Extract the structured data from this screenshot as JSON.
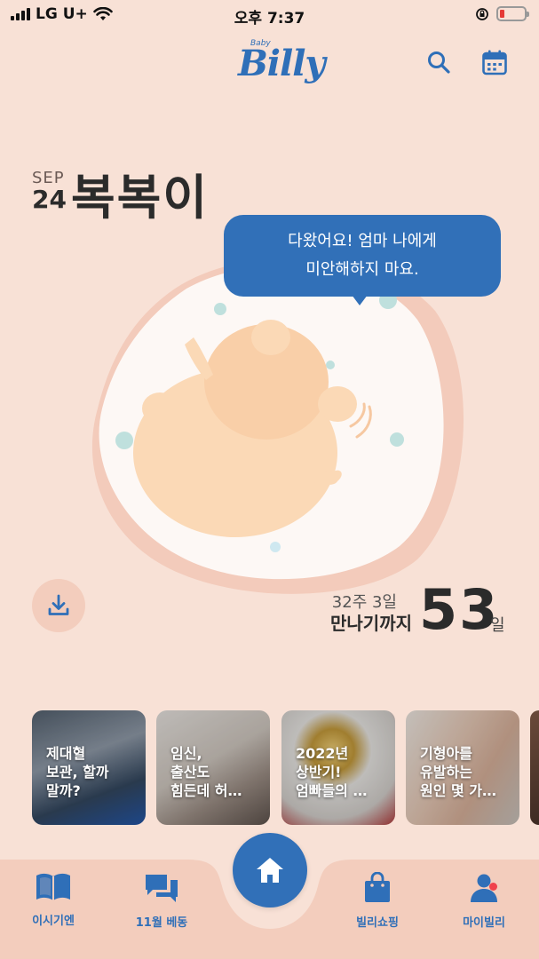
{
  "status_bar": {
    "carrier": "LG U+",
    "time": "오후 7:37"
  },
  "header": {
    "logo_small": "Baby",
    "logo_main": "Billy"
  },
  "baby": {
    "month": "SEP",
    "day": "24",
    "name": "복복이"
  },
  "speech": {
    "line1": "다왔어요! 엄마 나에게",
    "line2": "미안해하지 마요."
  },
  "pregnancy": {
    "weeks": "32주 3일",
    "until_label": "만나기까지",
    "days_left": "53",
    "days_unit": "일"
  },
  "cards": [
    {
      "line1": "제대혈",
      "line2": "보관, 할까",
      "line3": "말까?"
    },
    {
      "line1": "임신,",
      "line2": "출산도",
      "line3": "힘든데 허…"
    },
    {
      "line1": "2022년",
      "line2": "상반기!",
      "line3": "엄빠들의 …"
    },
    {
      "line1": "기형아를",
      "line2": "유발하는",
      "line3": "원인 몇 가…"
    }
  ],
  "nav": {
    "story": "이시기엔",
    "community": "11월 베동",
    "shop": "빌리쇼핑",
    "my": "마이빌리"
  },
  "colors": {
    "background": "#f8e1d6",
    "brand_blue": "#3170b8",
    "nav_bg": "#f3cdbd",
    "battery_low": "#e53935",
    "notification": "#f0424c"
  }
}
